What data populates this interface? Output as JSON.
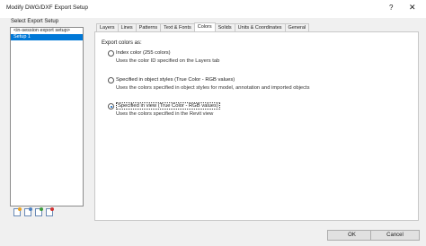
{
  "window": {
    "title": "Modify DWG/DXF Export Setup",
    "help": "?",
    "close": "✕"
  },
  "setups": {
    "label": "Select Export Setup",
    "items": [
      {
        "label": "<in-session export setup>",
        "selected": false
      },
      {
        "label": "Setup 1",
        "selected": true
      }
    ]
  },
  "toolbar": {
    "icons": [
      "new-setup-icon",
      "duplicate-setup-icon",
      "rename-setup-icon",
      "delete-setup-icon"
    ]
  },
  "tabs": [
    "Layers",
    "Lines",
    "Patterns",
    "Text & Fonts",
    "Colors",
    "Solids",
    "Units & Coordinates",
    "General"
  ],
  "active_tab": "Colors",
  "colors": {
    "export_label": "Export colors as:",
    "options": [
      {
        "label": "Index color (255 colors)",
        "desc": "Uses the color ID specified on the Layers tab",
        "selected": false
      },
      {
        "label": "Specified in object styles (True Color - RGB values)",
        "desc": "Uses the colors specified in object styles for model, annotation and imported objects",
        "selected": false
      },
      {
        "label": "Specified in view (True Color - RGB values)",
        "desc": "Uses the colors specified in the Revit view",
        "selected": true
      }
    ]
  },
  "buttons": {
    "ok": "OK",
    "cancel": "Cancel"
  }
}
